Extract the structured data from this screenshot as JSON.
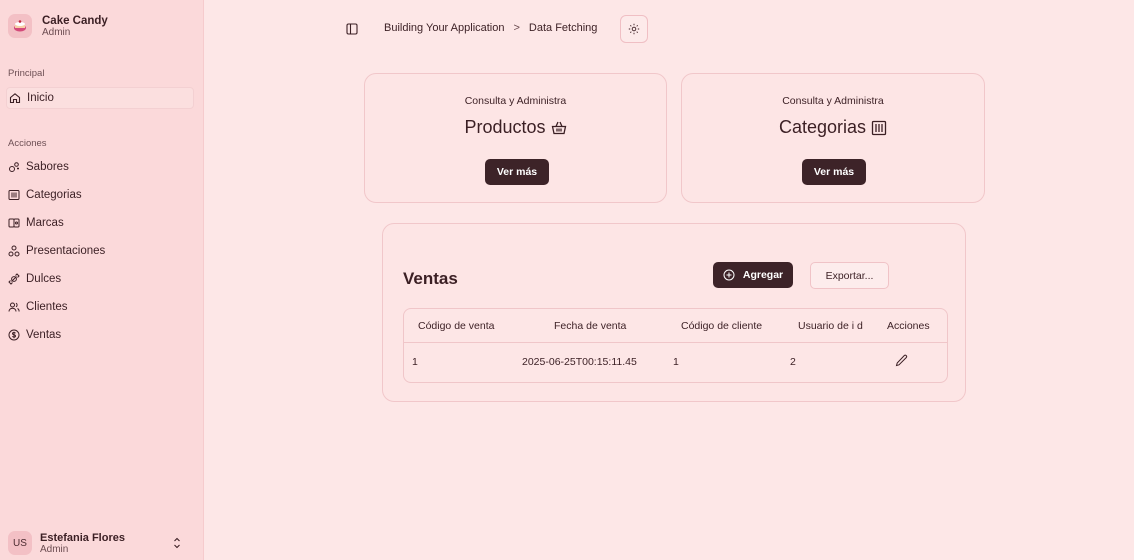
{
  "brand": {
    "name": "Cake Candy",
    "role": "Admin"
  },
  "sidebar": {
    "principal_label": "Principal",
    "inicio": "Inicio",
    "acciones_label": "Acciones",
    "items": [
      {
        "label": "Sabores",
        "icon": "flavors-icon"
      },
      {
        "label": "Categorias",
        "icon": "library-icon"
      },
      {
        "label": "Marcas",
        "icon": "tags-icon"
      },
      {
        "label": "Presentaciones",
        "icon": "shapes-icon"
      },
      {
        "label": "Dulces",
        "icon": "candy-icon"
      },
      {
        "label": "Clientes",
        "icon": "users-icon"
      },
      {
        "label": "Ventas",
        "icon": "dollar-circle-icon"
      }
    ]
  },
  "user": {
    "initials": "US",
    "name": "Estefania Flores",
    "role": "Admin"
  },
  "header": {
    "breadcrumb": [
      "Building Your Application",
      "Data Fetching"
    ],
    "breadcrumb_separator": ">"
  },
  "cards": [
    {
      "subtitle": "Consulta y Administra",
      "title": "Productos",
      "button": "Ver más"
    },
    {
      "subtitle": "Consulta y Administra",
      "title": "Categorias",
      "button": "Ver más"
    }
  ],
  "ventas": {
    "title": "Ventas",
    "add_button": "Agregar",
    "export_button": "Exportar...",
    "columns": [
      "Código de venta",
      "Fecha de venta",
      "Código de cliente",
      "Usuario de i d",
      "Acciones"
    ],
    "rows": [
      {
        "codigo": "1",
        "fecha": "2025-06-25T00:15:11.45",
        "cliente": "1",
        "usuario": "2"
      }
    ]
  },
  "colors": {
    "accent": "#3d2328",
    "background": "#fde7e7",
    "sidebar": "#fbd9da"
  }
}
